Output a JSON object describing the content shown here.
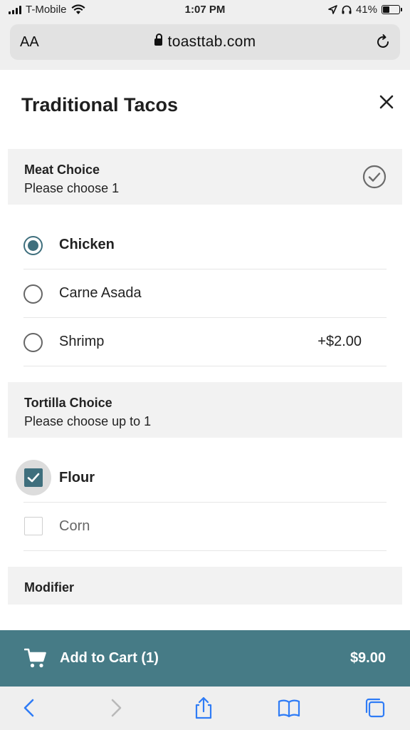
{
  "status_bar": {
    "carrier": "T-Mobile",
    "time": "1:07 PM",
    "battery": "41%",
    "battery_level": 0.41
  },
  "browser": {
    "text_size_label": "AA",
    "url": "toasttab.com"
  },
  "item": {
    "title": "Traditional Tacos"
  },
  "meat_choice": {
    "name": "Meat Choice",
    "instruction": "Please choose 1",
    "options": [
      {
        "label": "Chicken",
        "price": "",
        "selected": true
      },
      {
        "label": "Carne Asada",
        "price": "",
        "selected": false
      },
      {
        "label": "Shrimp",
        "price": "+$2.00",
        "selected": false
      }
    ]
  },
  "tortilla_choice": {
    "name": "Tortilla Choice",
    "instruction": "Please choose up to 1",
    "options": [
      {
        "label": "Flour",
        "checked": true
      },
      {
        "label": "Corn",
        "checked": false
      }
    ]
  },
  "modifier": {
    "name": "Modifier"
  },
  "cart": {
    "label": "Add to Cart (1)",
    "total": "$9.00"
  },
  "colors": {
    "accent": "#467b86",
    "selected": "#3f6f7d"
  },
  "icons": [
    "signal-icon",
    "wifi-icon",
    "location-icon",
    "headphones-icon",
    "battery-icon",
    "lock-icon",
    "reload-icon",
    "close-icon",
    "check-circle-icon",
    "cart-icon",
    "back-icon",
    "forward-icon",
    "share-icon",
    "bookmarks-icon",
    "tabs-icon"
  ]
}
